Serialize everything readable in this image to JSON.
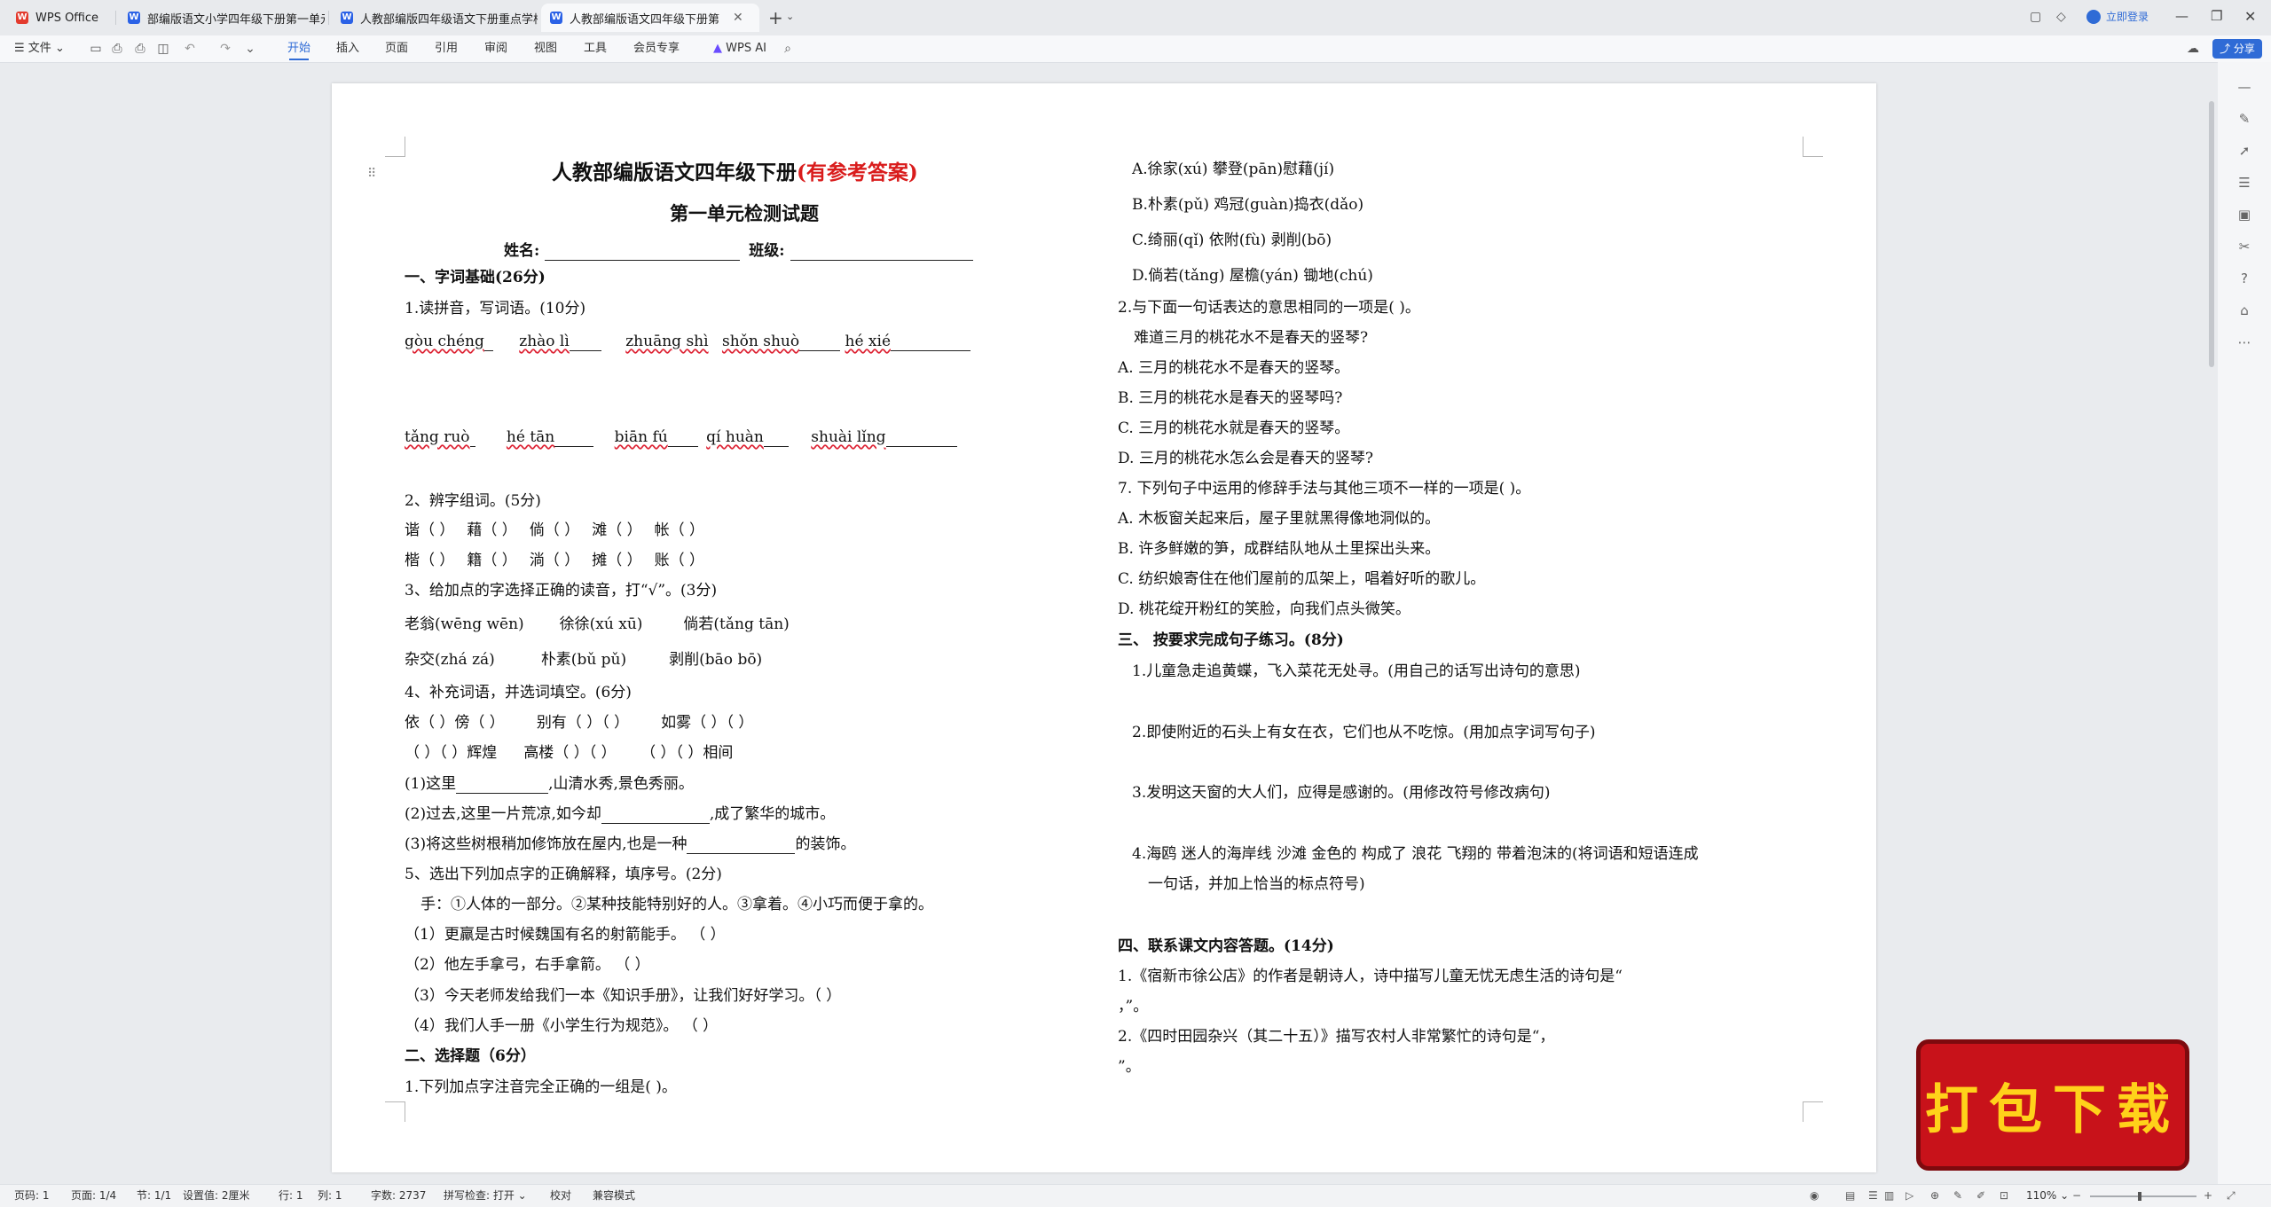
{
  "titlebar": {
    "tabs": [
      {
        "label": "WPS Office",
        "icon": "wps-logo-icon"
      },
      {
        "label": "部编版语文小学四年级下册第一单元",
        "icon": "word-doc-icon"
      },
      {
        "label": "人教部编版四年级语文下册重点学校",
        "icon": "word-doc-icon"
      },
      {
        "label": "人教部编版语文四年级下册第",
        "icon": "word-doc-icon",
        "active": true
      }
    ],
    "new_tab": "+",
    "login": "立即登录"
  },
  "ribbon": {
    "file_menu": "文件",
    "tabs": [
      "开始",
      "插入",
      "页面",
      "引用",
      "审阅",
      "视图",
      "工具",
      "会员专享"
    ],
    "active_tab": "开始",
    "wps_ai": "WPS AI",
    "share": "分享"
  },
  "document": {
    "left": {
      "title": "人教部编版语文四年级下册",
      "title_red": "(有参考答案)",
      "subtitle": "第一单元检测试题",
      "name_label": "姓名:",
      "class_label": "班级:",
      "s1": "一、字词基础(26分)",
      "q1": "1.读拼音，写词语。(10分)",
      "pinyin_row1": [
        "gòu chéng",
        "zhào lì",
        "zhuāng shì",
        "shǒn shuò",
        "hé xié"
      ],
      "pinyin_row2": [
        "tǎng ruò",
        "hé tān",
        "biān fú",
        "qí huàn",
        "shuài lǐng"
      ],
      "q2": "2、辨字组词。(5分)",
      "q2_row1": [
        "谐（        ）",
        "藉（        ）",
        "倘（        ）",
        "滩（        ）",
        "帐（        ）"
      ],
      "q2_row2": [
        "楷（        ）",
        "籍（        ）",
        "淌（        ）",
        "摊（        ）",
        "账（        ）"
      ],
      "q3": "3、给加点的字选择正确的读音，打“√”。(3分)",
      "q3_row1": [
        "老翁(wēng   wēn)",
        "徐徐(xú   xū)",
        "倘若(tǎng   tān)"
      ],
      "q3_row2": [
        "杂交(zhá   zá)",
        "朴素(bǔ   pǔ)",
        "剥削(bāo   bō)"
      ],
      "q4": "4、补充词语，并选词填空。(6分)",
      "q4_row1": [
        "依（     ）傍（     ）",
        "别有（     ）（     ）",
        "如雾（     ）（     ）"
      ],
      "q4_row2": [
        "（     ）（     ）辉煌",
        "高楼（     ）（     ）",
        "（     ）（     ）相间"
      ],
      "q4_1a": "(1)这里",
      "q4_1b": ",山清水秀,景色秀丽。",
      "q4_2a": "(2)过去,这里一片荒凉,如今却",
      "q4_2b": ",成了繁华的城市。",
      "q4_3a": "(3)将这些树根稍加修饰放在屋内,也是一种",
      "q4_3b": "的装饰。",
      "q5": "5、选出下列加点字的正确解释，填序号。(2分)",
      "q5_def": "手：①人体的一部分。②某种技能特别好的人。③拿着。④小巧而便于拿的。",
      "q5_items": [
        "（1）更羸是古时候魏国有名的射箭能手。      （        ）",
        "（2）他左手拿弓，右手拿箭。              （        ）",
        "（3）今天老师发给我们一本《知识手册》，让我们好好学习。（        ）",
        "（4）我们人手一册《小学生行为规范》。  （        ）"
      ],
      "s2": "二、选择题（6分）",
      "mc1": "1.下列加点字注音完全正确的一组是(       )。"
    },
    "right": {
      "opts1": [
        "A.徐家(xú)   攀登(pān)慰藉(jí)",
        "B.朴素(pǔ)   鸡冠(guàn)捣衣(dǎo)",
        "C.绮丽(qǐ)   依附(fù)   剥削(bō)",
        "D.倘若(tǎng)   屋檐(yán)   锄地(chú)"
      ],
      "mc2": "2.与下面一句话表达的意思相同的一项是(       )。",
      "mc2_q": "难道三月的桃花水不是春天的竖琴?",
      "mc2_opts": [
        "A.  三月的桃花水不是春天的竖琴。",
        "B.  三月的桃花水是春天的竖琴吗?",
        "C.  三月的桃花水就是春天的竖琴。",
        "D.  三月的桃花水怎么会是春天的竖琴?"
      ],
      "mc3": "7.  下列句子中运用的修辞手法与其他三项不一样的一项是(       )。",
      "mc3_opts": [
        "A.  木板窗关起来后，屋子里就黑得像地洞似的。",
        "B.  许多鲜嫩的笋，成群结队地从土里探出头来。",
        "C.  纺织娘寄住在他们屋前的瓜架上，唱着好听的歌儿。",
        "D.  桃花绽开粉红的笑脸，向我们点头微笑。"
      ],
      "s3": "三、   按要求完成句子练习。(8分)",
      "s3_items": [
        "1.儿童急走追黄蝶，飞入菜花无处寻。(用自己的话写出诗句的意思)",
        "2.即使附近的石头上有女在衣，它们也从不吃惊。(用加点字词写句子)",
        "3.发明这天窗的大人们，应得是感谢的。(用修改符号修改病句)",
        "4.海鸥   迷人的海岸线   沙滩   金色的   构成了   浪花   飞翔的   带着泡沫的(将词语和短语连成"
      ],
      "s3_item4b": "一句话，并加上恰当的标点符号)",
      "s4": "四、联系课文内容答题。(14分)",
      "s4_1a": "1.《宿新市徐公店》的作者是朝诗人，诗中描写儿童无忧无虑生活的诗句是“",
      "s4_1b": "，”。",
      "s4_2a": "2.《四时田园杂兴（其二十五）》描写农村人非常繁忙的诗句是“，",
      "s4_2b": "”。"
    }
  },
  "statusbar": {
    "page_code": "页码: 1",
    "page": "页面: 1/4",
    "section": "节: 1/1",
    "setting": "设置值: 2厘米",
    "row": "行: 1",
    "col": "列: 1",
    "words": "字数: 2737",
    "spell": "拼写检查: 打开",
    "proof": "校对",
    "compat": "兼容模式",
    "zoom": "110%"
  },
  "badge": {
    "text": "打包下载"
  }
}
